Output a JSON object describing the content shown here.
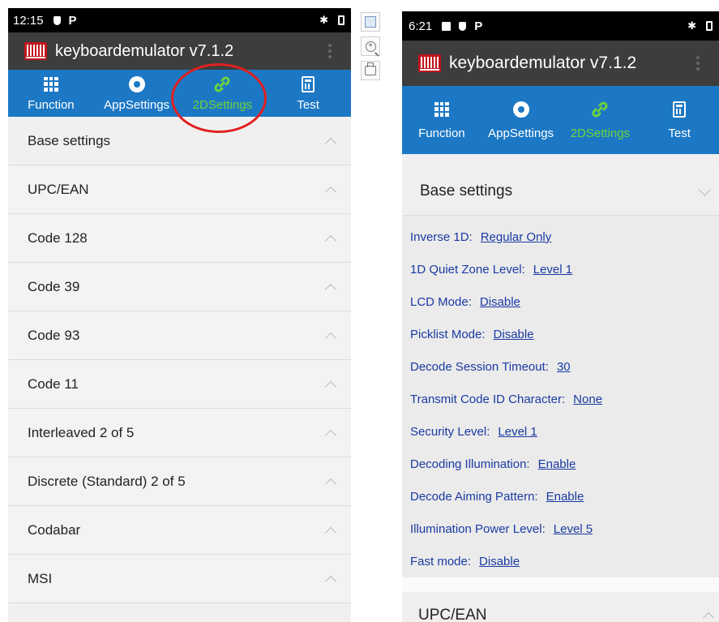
{
  "left_phone": {
    "status_time": "12:15",
    "status_p": "P",
    "bluetooth": "✱",
    "app_title": "keyboardemulator v7.1.2",
    "tabs": [
      {
        "label": "Function",
        "icon": "grid-icon"
      },
      {
        "label": "AppSettings",
        "icon": "gear-icon"
      },
      {
        "label": "2DSettings",
        "icon": "link-icon",
        "active": true
      },
      {
        "label": "Test",
        "icon": "calculator-icon"
      }
    ],
    "sections": [
      "Base settings",
      "UPC/EAN",
      "Code 128",
      "Code 39",
      "Code 93",
      "Code 11",
      "Interleaved 2 of 5",
      "Discrete (Standard) 2 of 5",
      "Codabar",
      "MSI"
    ]
  },
  "right_phone": {
    "status_time": "6:21",
    "status_p": "P",
    "bluetooth": "✱",
    "app_title": "keyboardemulator v7.1.2",
    "tabs": [
      {
        "label": "Function",
        "icon": "grid-icon"
      },
      {
        "label": "AppSettings",
        "icon": "gear-icon"
      },
      {
        "label": "2DSettings",
        "icon": "link-icon",
        "active": true
      },
      {
        "label": "Test",
        "icon": "calculator-icon"
      }
    ],
    "expanded_section": "Base settings",
    "settings": [
      {
        "label": "Inverse 1D:",
        "value": "Regular Only"
      },
      {
        "label": "1D Quiet Zone Level:",
        "value": "Level 1"
      },
      {
        "label": "LCD Mode:",
        "value": "Disable"
      },
      {
        "label": "Picklist Mode:",
        "value": "Disable"
      },
      {
        "label": "Decode Session Timeout:",
        "value": "30"
      },
      {
        "label": "Transmit Code ID Character:",
        "value": "None"
      },
      {
        "label": "Security Level:",
        "value": "Level 1"
      },
      {
        "label": "Decoding Illumination:",
        "value": "Enable"
      },
      {
        "label": "Decode Aiming Pattern:",
        "value": "Enable"
      },
      {
        "label": "Illumination Power Level:",
        "value": "Level 5"
      },
      {
        "label": "Fast mode:",
        "value": "Disable"
      }
    ],
    "next_section": "UPC/EAN"
  },
  "viewer_toolbar": {
    "zoom_symbol": "+",
    "icons": [
      "fit-to-window-icon",
      "zoom-in-icon",
      "print-icon"
    ]
  },
  "colors": {
    "tab_bar": "#1c78c4",
    "active_tab": "#6fd43a",
    "app_bar": "#3d3d3d",
    "highlight_circle": "#e02020",
    "setting_text": "#1a3aa3"
  }
}
